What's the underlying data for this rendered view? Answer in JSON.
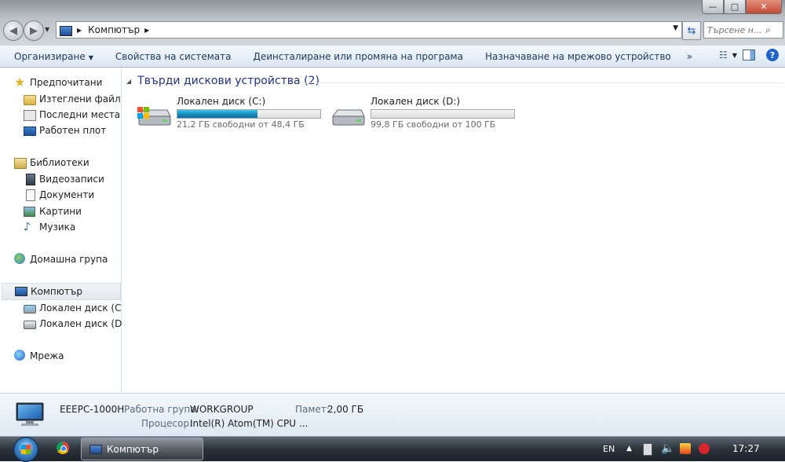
{
  "window": {
    "address": {
      "current": "Компютър"
    },
    "search": {
      "placeholder": "Търсене н..."
    },
    "controls": {
      "minimize": "—",
      "maximize": "□",
      "close": "✕"
    }
  },
  "commandbar": {
    "organize": "Организиране",
    "system_properties": "Свойства на системата",
    "uninstall": "Деинсталиране или промяна на програма",
    "map_drive": "Назначаване на мрежово устройство",
    "more": "»"
  },
  "navigation": {
    "favorites": {
      "label": "Предпочитани",
      "items": [
        "Изтеглени файлове",
        "Последни места",
        "Работен плот"
      ]
    },
    "libraries": {
      "label": "Библиотеки",
      "items": [
        "Видеозаписи",
        "Документи",
        "Картини",
        "Музика"
      ]
    },
    "homegroup": "Домашна група",
    "computer": {
      "label": "Компютър",
      "items": [
        "Локален диск (C:)",
        "Локален диск (D:)"
      ]
    },
    "network": "Мрежа"
  },
  "content": {
    "group_title": "Твърди дискови устройства (2)",
    "drives": [
      {
        "name": "Локален диск (C:)",
        "free_text": "21,2 ГБ свободни от 48,4 ГБ",
        "used_fraction": 0.56
      },
      {
        "name": "Локален диск (D:)",
        "free_text": "99,8 ГБ свободни от 100 ГБ",
        "used_fraction": 0.002
      }
    ]
  },
  "details": {
    "computer_name": "EEEPC-1000H",
    "workgroup_label": "Работна група:",
    "workgroup_value": "WORKGROUP",
    "memory_label": "Памет:",
    "memory_value": "2,00 ГБ",
    "processor_label": "Процесор:",
    "processor_value": "Intel(R) Atom(TM) CPU ..."
  },
  "taskbar": {
    "window_button": "Компютър",
    "language": "EN",
    "clock": "17:27"
  }
}
